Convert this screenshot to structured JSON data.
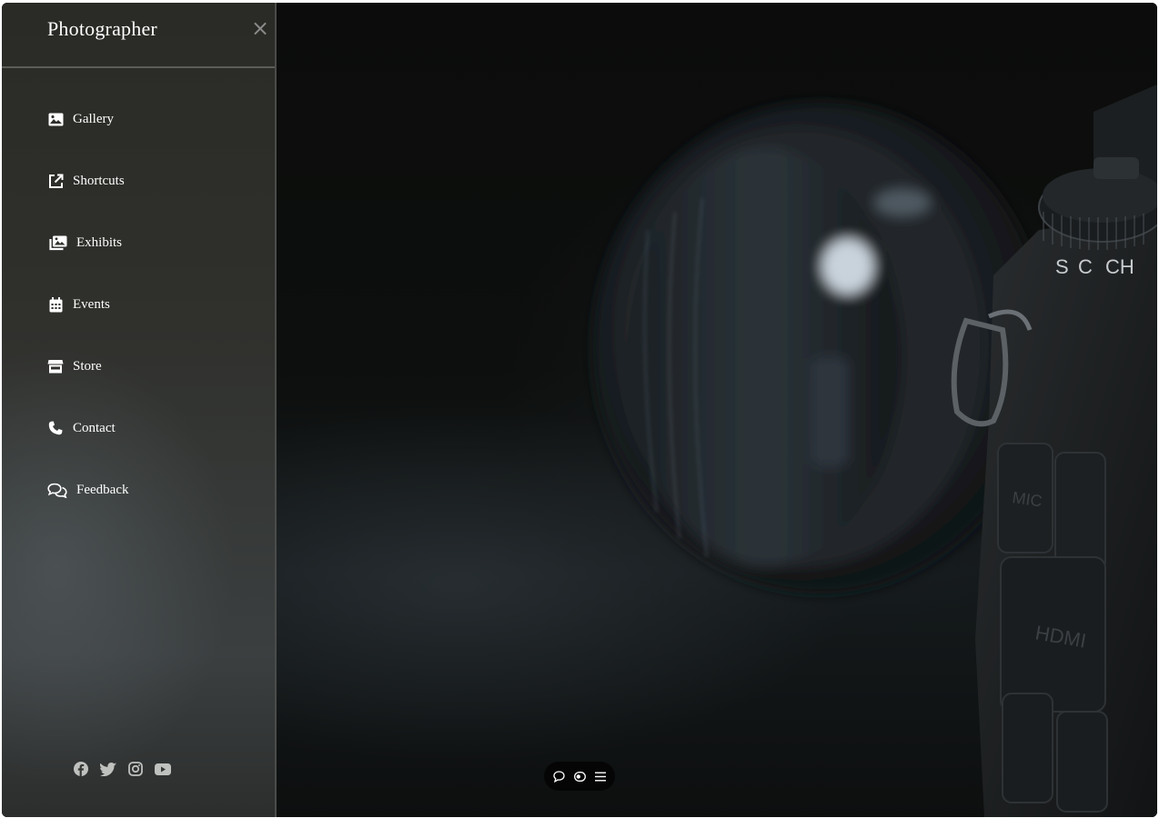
{
  "sidebar": {
    "brand": "Photographer",
    "close_label": "×",
    "items": [
      {
        "label": "Gallery",
        "icon": "image-icon"
      },
      {
        "label": "Shortcuts",
        "icon": "external-link-icon"
      },
      {
        "label": "Exhibits",
        "icon": "images-stack-icon"
      },
      {
        "label": "Events",
        "icon": "calendar-icon"
      },
      {
        "label": "Store",
        "icon": "store-icon"
      },
      {
        "label": "Contact",
        "icon": "phone-icon"
      },
      {
        "label": "Feedback",
        "icon": "comments-icon"
      }
    ],
    "socials": [
      "facebook-icon",
      "twitter-icon",
      "instagram-icon",
      "youtube-icon"
    ]
  },
  "hero": {
    "camera_mode_dial_labels": [
      "S",
      "C",
      "CH"
    ],
    "port_labels": [
      "MIC",
      "HDMI"
    ]
  },
  "controls": {
    "buttons": [
      "chat-icon",
      "toggle-icon",
      "menu-icon"
    ]
  },
  "colors": {
    "sidebar_bg": "#2f2f2b",
    "text": "#ffffff",
    "close": "#8a8c89",
    "pill_bg": "#050505",
    "social_icon": "#bfc1be"
  }
}
